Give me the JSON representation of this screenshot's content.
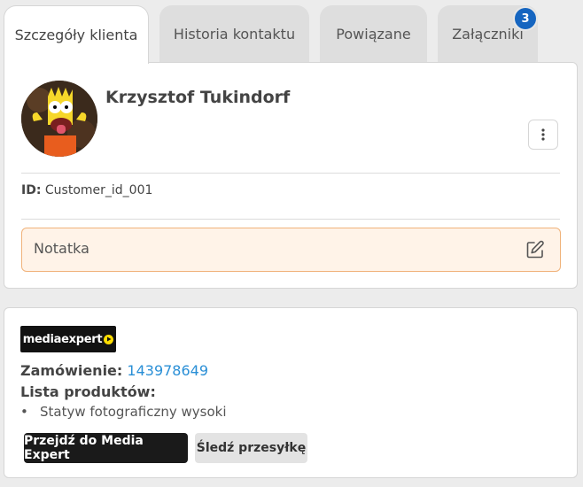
{
  "tabs": [
    {
      "label": "Szczegóły klienta",
      "active": true
    },
    {
      "label": "Historia kontaktu",
      "active": false
    },
    {
      "label": "Powiązane",
      "active": false
    },
    {
      "label": "Załączniki",
      "active": false,
      "badge": "3"
    }
  ],
  "customer": {
    "name": "Krzysztof Tukindorf",
    "avatar_icon": "cartoon-avatar",
    "id_label": "ID:",
    "id_value": "Customer_id_001",
    "menu_icon": "more-vertical-icon"
  },
  "note": {
    "label": "Notatka",
    "edit_icon": "edit-icon",
    "bg_color": "#fff3e8",
    "border_color": "#f0b27a"
  },
  "order": {
    "logo_text": "mediaexpert",
    "order_label": "Zamówienie:",
    "order_number": "143978649",
    "products_label": "Lista produktów:",
    "products": [
      "Statyw fotograficzny wysoki"
    ],
    "primary_button": "Przejdź do Media Expert",
    "secondary_button": "Śledź przesyłkę",
    "link_color": "#2a8fd6"
  },
  "colors": {
    "badge": "#1565c0",
    "dark_button": "#1a1a1a",
    "logo_accent": "#ffdd00"
  }
}
